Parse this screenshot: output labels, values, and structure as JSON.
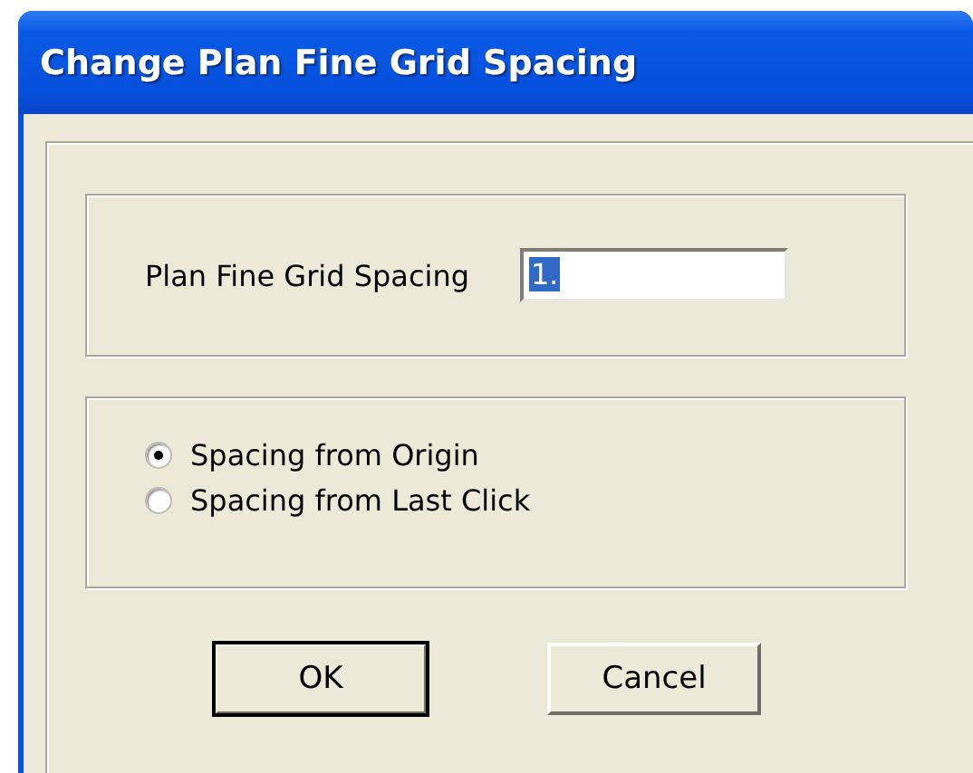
{
  "window": {
    "title": "Change Plan Fine Grid Spacing"
  },
  "spacing_field": {
    "label": "Plan Fine Grid Spacing",
    "value": "1.",
    "value_highlighted": true
  },
  "options": [
    {
      "label": "Spacing from Origin",
      "selected": true
    },
    {
      "label": "Spacing from Last Click",
      "selected": false
    }
  ],
  "buttons": [
    {
      "label": "OK",
      "default": true
    },
    {
      "label": "Cancel",
      "default": false
    }
  ]
}
